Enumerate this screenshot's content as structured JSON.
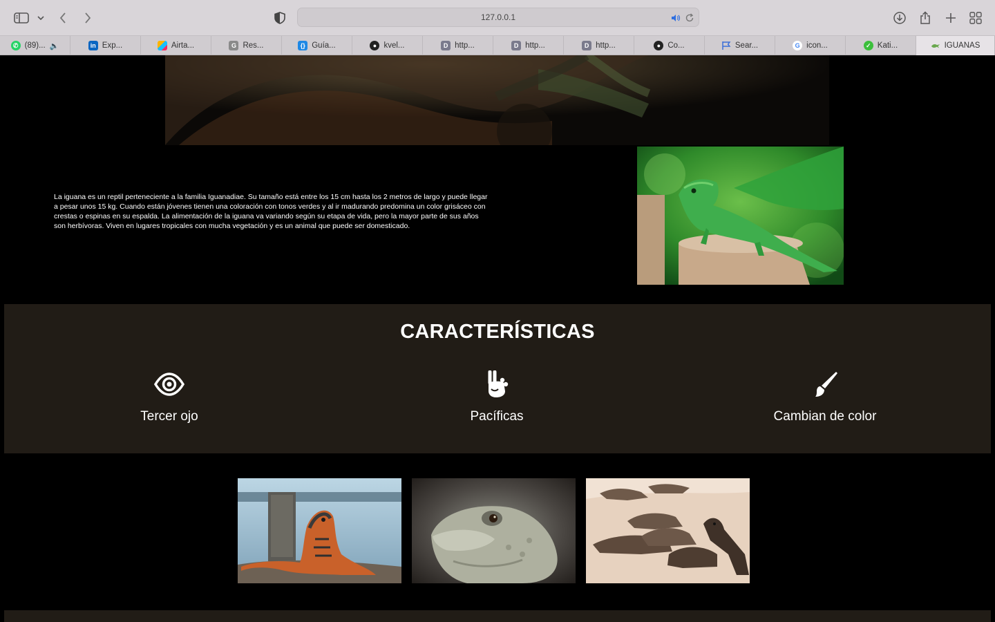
{
  "browser": {
    "url": "127.0.0.1",
    "tabs": [
      {
        "label": "(89)...",
        "icon": "whatsapp-icon",
        "color": "#25D366"
      },
      {
        "label": "Exp...",
        "icon": "linkedin-icon",
        "color": "#0A66C2"
      },
      {
        "label": "Airta...",
        "icon": "airtable-icon",
        "color": "#FCB400"
      },
      {
        "label": "Res...",
        "icon": "g-icon",
        "color": "#8a8a8a"
      },
      {
        "label": "Guía...",
        "icon": "code-icon",
        "color": "#1E88E5"
      },
      {
        "label": "kvel...",
        "icon": "github-icon",
        "color": "#222222"
      },
      {
        "label": "http...",
        "icon": "d-icon",
        "color": "#7a7a8c"
      },
      {
        "label": "http...",
        "icon": "d-icon",
        "color": "#7a7a8c"
      },
      {
        "label": "http...",
        "icon": "d-icon",
        "color": "#7a7a8c"
      },
      {
        "label": "Co...",
        "icon": "github-icon",
        "color": "#222222"
      },
      {
        "label": "Sear...",
        "icon": "flag-icon",
        "color": "#3b6fd8"
      },
      {
        "label": "icon...",
        "icon": "google-icon",
        "color": "#4285F4"
      },
      {
        "label": "Kati...",
        "icon": "katib-icon",
        "color": "#3cbf3c"
      },
      {
        "label": "IGUANAS",
        "icon": "iguana-icon",
        "color": "#6aa84f",
        "active": true
      }
    ]
  },
  "intro": {
    "text": "La iguana es un reptil perteneciente a la familia Iguanadiae. Su tamaño está entre los 15 cm hasta los 2 metros de largo y puede llegar a pesar unos 15 kg. Cuando están jóvenes tienen una coloración con tonos verdes y al ir madurando predomina un color grisáceo con crestas o espinas en su espalda. La alimentación de la iguana va variando según su etapa de vida, pero la mayor parte de sus años son herbívoras. Viven en lugares tropicales con mucha vegetación y es un animal que puede ser domesticado."
  },
  "features": {
    "title": "CARACTERÍSTICAS",
    "items": [
      {
        "label": "Tercer ojo",
        "icon": "eye-icon"
      },
      {
        "label": "Pacíficas",
        "icon": "peace-hand-icon"
      },
      {
        "label": "Cambian de color",
        "icon": "paintbrush-icon"
      }
    ]
  },
  "colors": {
    "section_bg": "#211c16",
    "page_bg": "#000000",
    "text": "#ffffff"
  }
}
